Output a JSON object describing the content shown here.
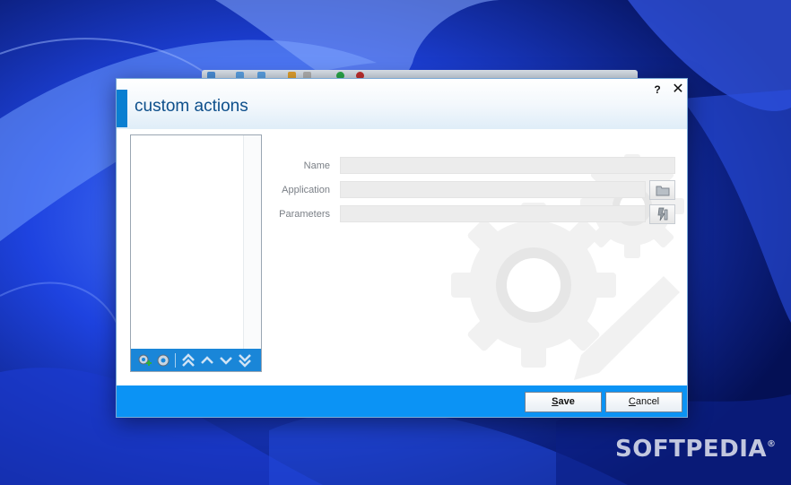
{
  "dialog": {
    "title": "custom actions",
    "help_label": "?",
    "close_label": "✕"
  },
  "list": {
    "items": [],
    "toolbar": [
      {
        "name": "add-action-button",
        "icon": "gear-add-icon"
      },
      {
        "name": "edit-action-button",
        "icon": "gear-icon"
      },
      {
        "name": "move-top-button",
        "icon": "double-chevron-up-icon"
      },
      {
        "name": "move-up-button",
        "icon": "chevron-up-icon"
      },
      {
        "name": "move-down-button",
        "icon": "chevron-down-icon"
      },
      {
        "name": "move-bottom-button",
        "icon": "double-chevron-down-icon"
      }
    ]
  },
  "form": {
    "name_label": "Name",
    "name_value": "",
    "application_label": "Application",
    "application_value": "",
    "parameters_label": "Parameters",
    "parameters_value": "",
    "browse_icon": "folder-icon",
    "parameters_icon": "tools-icon"
  },
  "footer": {
    "save_first": "S",
    "save_rest": "ave",
    "cancel_first": "C",
    "cancel_rest": "ancel"
  },
  "watermark": {
    "brand": "SOFTPEDIA",
    "mark": "®"
  },
  "colors": {
    "accent": "#0a7fd1",
    "footer": "#0b93f5",
    "toolbar": "#1a86d8",
    "title": "#0d4f8b"
  }
}
